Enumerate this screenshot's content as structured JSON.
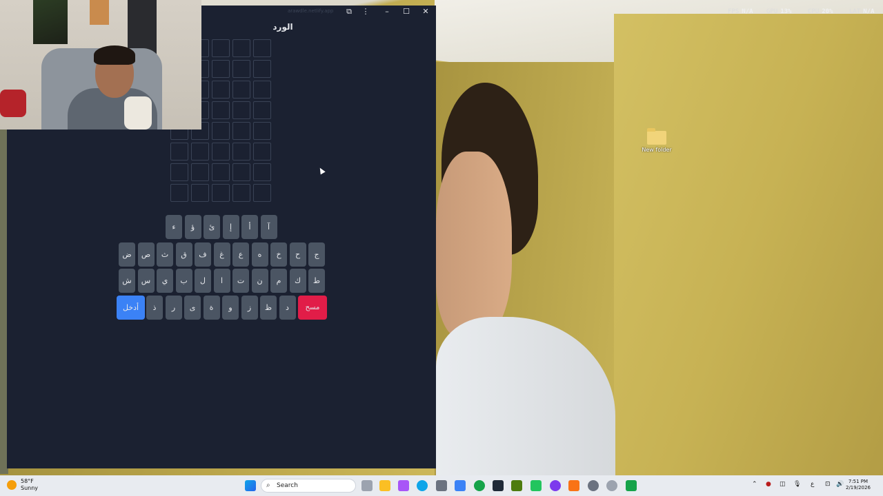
{
  "window": {
    "url": "arawdle.netlify.app",
    "title": "الورد"
  },
  "grid": {
    "rows": 8,
    "cols": 5
  },
  "keyboard": {
    "row1": [
      "ء",
      "ؤ",
      "ئ",
      "إ",
      "أ",
      "آ"
    ],
    "row2": [
      "ض",
      "ص",
      "ث",
      "ق",
      "ف",
      "غ",
      "ع",
      "ه",
      "خ",
      "ح",
      "ج"
    ],
    "row3": [
      "ش",
      "س",
      "ي",
      "ب",
      "ل",
      "ا",
      "ت",
      "ن",
      "م",
      "ك",
      "ط"
    ],
    "row4": [
      "ذ",
      "ر",
      "ى",
      "ة",
      "و",
      "ز",
      "ظ",
      "د"
    ],
    "enter_label": "أدخل",
    "delete_label": "مسح"
  },
  "overlay": {
    "fps_label": "FPS",
    "fps_value": "N/A",
    "gpu_label": "GPU",
    "gpu_value": "13%",
    "cpu_label": "CPU",
    "cpu_value": "20%",
    "lat_label": "LAT",
    "lat_value": "N/A"
  },
  "desktop": {
    "folder_label": "New folder"
  },
  "taskbar": {
    "temperature": "58°F",
    "condition": "Sunny",
    "search_placeholder": "Search",
    "ime": "ع",
    "time": "7:51 PM",
    "date": "2/19/2026"
  }
}
